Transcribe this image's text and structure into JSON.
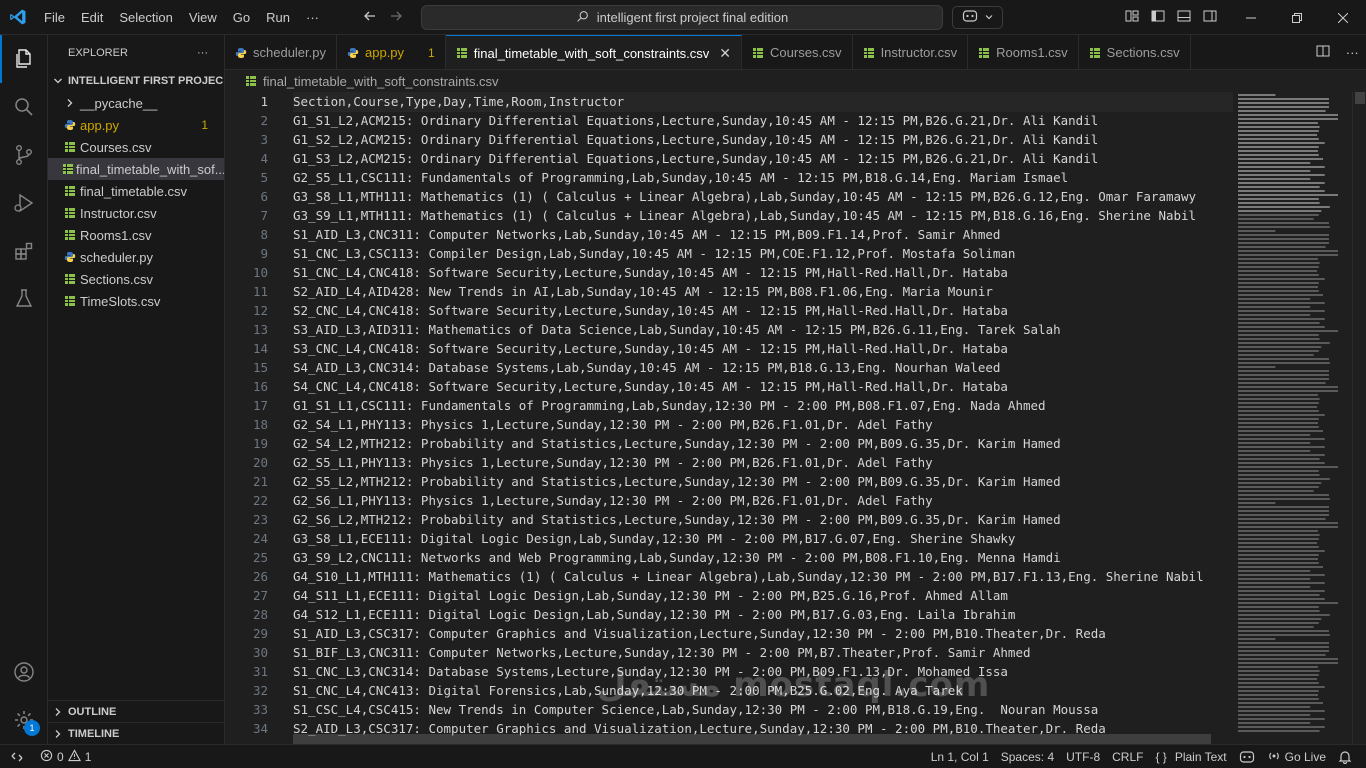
{
  "titlebar": {
    "menu": [
      "File",
      "Edit",
      "Selection",
      "View",
      "Go",
      "Run",
      "···"
    ],
    "search_text": "intelligent first project final edition"
  },
  "colors": {
    "accent": "#0078d4",
    "warning": "#cca700",
    "csv_icon": "#8dc149",
    "python_icon": "#3b78c4"
  },
  "activitybar": {
    "items": [
      "files-icon",
      "search-icon",
      "source-control-icon",
      "run-debug-icon",
      "extensions-icon",
      "testing-icon"
    ],
    "bottom": [
      "account-icon",
      "manage-gear-icon"
    ],
    "manage_badge": "1"
  },
  "sidebar": {
    "title": "EXPLORER",
    "more": "···",
    "folder": "INTELLIGENT FIRST PROJEC...",
    "files": [
      {
        "name": "__pycache__",
        "type": "folder"
      },
      {
        "name": "app.py",
        "type": "python",
        "badge": "1"
      },
      {
        "name": "Courses.csv",
        "type": "csv"
      },
      {
        "name": "final_timetable_with_sof...",
        "type": "csv"
      },
      {
        "name": "final_timetable.csv",
        "type": "csv"
      },
      {
        "name": "Instructor.csv",
        "type": "csv"
      },
      {
        "name": "Rooms1.csv",
        "type": "csv"
      },
      {
        "name": "scheduler.py",
        "type": "python"
      },
      {
        "name": "Sections.csv",
        "type": "csv"
      },
      {
        "name": "TimeSlots.csv",
        "type": "csv"
      }
    ],
    "outline": "OUTLINE",
    "timeline": "TIMELINE"
  },
  "tabs": [
    {
      "label": "scheduler.py",
      "type": "python"
    },
    {
      "label": "app.py",
      "type": "python",
      "badge": "1"
    },
    {
      "label": "final_timetable_with_soft_constraints.csv",
      "type": "csv",
      "active": true,
      "close": "✕"
    },
    {
      "label": "Courses.csv",
      "type": "csv"
    },
    {
      "label": "Instructor.csv",
      "type": "csv"
    },
    {
      "label": "Rooms1.csv",
      "type": "csv"
    },
    {
      "label": "Sections.csv",
      "type": "csv"
    }
  ],
  "breadcrumb": "final_timetable_with_soft_constraints.csv",
  "editor": {
    "lines": [
      "Section,Course,Type,Day,Time,Room,Instructor",
      "G1_S1_L2,ACM215: Ordinary Differential Equations,Lecture,Sunday,10:45 AM - 12:15 PM,B26.G.21,Dr. Ali Kandil",
      "G1_S2_L2,ACM215: Ordinary Differential Equations,Lecture,Sunday,10:45 AM - 12:15 PM,B26.G.21,Dr. Ali Kandil",
      "G1_S3_L2,ACM215: Ordinary Differential Equations,Lecture,Sunday,10:45 AM - 12:15 PM,B26.G.21,Dr. Ali Kandil",
      "G2_S5_L1,CSC111: Fundamentals of Programming,Lab,Sunday,10:45 AM - 12:15 PM,B18.G.14,Eng. Mariam Ismael",
      "G3_S8_L1,MTH111: Mathematics (1) ( Calculus + Linear Algebra),Lab,Sunday,10:45 AM - 12:15 PM,B26.G.12,Eng. Omar Faramawy",
      "G3_S9_L1,MTH111: Mathematics (1) ( Calculus + Linear Algebra),Lab,Sunday,10:45 AM - 12:15 PM,B18.G.16,Eng. Sherine Nabil",
      "S1_AID_L3,CNC311: Computer Networks,Lab,Sunday,10:45 AM - 12:15 PM,B09.F1.14,Prof. Samir Ahmed",
      "S1_CNC_L3,CSC113: Compiler Design,Lab,Sunday,10:45 AM - 12:15 PM,COE.F1.12,Prof. Mostafa Soliman",
      "S1_CNC_L4,CNC418: Software Security,Lecture,Sunday,10:45 AM - 12:15 PM,Hall-Red.Hall,Dr. Hataba",
      "S2_AID_L4,AID428: New Trends in AI,Lab,Sunday,10:45 AM - 12:15 PM,B08.F1.06,Eng. Maria Mounir",
      "S2_CNC_L4,CNC418: Software Security,Lecture,Sunday,10:45 AM - 12:15 PM,Hall-Red.Hall,Dr. Hataba",
      "S3_AID_L3,AID311: Mathematics of Data Science,Lab,Sunday,10:45 AM - 12:15 PM,B26.G.11,Eng. Tarek Salah",
      "S3_CNC_L4,CNC418: Software Security,Lecture,Sunday,10:45 AM - 12:15 PM,Hall-Red.Hall,Dr. Hataba",
      "S4_AID_L3,CNC314: Database Systems,Lab,Sunday,10:45 AM - 12:15 PM,B18.G.13,Eng. Nourhan Waleed",
      "S4_CNC_L4,CNC418: Software Security,Lecture,Sunday,10:45 AM - 12:15 PM,Hall-Red.Hall,Dr. Hataba",
      "G1_S1_L1,CSC111: Fundamentals of Programming,Lab,Sunday,12:30 PM - 2:00 PM,B08.F1.07,Eng. Nada Ahmed",
      "G2_S4_L1,PHY113: Physics 1,Lecture,Sunday,12:30 PM - 2:00 PM,B26.F1.01,Dr. Adel Fathy",
      "G2_S4_L2,MTH212: Probability and Statistics,Lecture,Sunday,12:30 PM - 2:00 PM,B09.G.35,Dr. Karim Hamed",
      "G2_S5_L1,PHY113: Physics 1,Lecture,Sunday,12:30 PM - 2:00 PM,B26.F1.01,Dr. Adel Fathy",
      "G2_S5_L2,MTH212: Probability and Statistics,Lecture,Sunday,12:30 PM - 2:00 PM,B09.G.35,Dr. Karim Hamed",
      "G2_S6_L1,PHY113: Physics 1,Lecture,Sunday,12:30 PM - 2:00 PM,B26.F1.01,Dr. Adel Fathy",
      "G2_S6_L2,MTH212: Probability and Statistics,Lecture,Sunday,12:30 PM - 2:00 PM,B09.G.35,Dr. Karim Hamed",
      "G3_S8_L1,ECE111: Digital Logic Design,Lab,Sunday,12:30 PM - 2:00 PM,B17.G.07,Eng. Sherine Shawky",
      "G3_S9_L2,CNC111: Networks and Web Programming,Lab,Sunday,12:30 PM - 2:00 PM,B08.F1.10,Eng. Menna Hamdi",
      "G4_S10_L1,MTH111: Mathematics (1) ( Calculus + Linear Algebra),Lab,Sunday,12:30 PM - 2:00 PM,B17.F1.13,Eng. Sherine Nabil",
      "G4_S11_L1,ECE111: Digital Logic Design,Lab,Sunday,12:30 PM - 2:00 PM,B25.G.16,Prof. Ahmed Allam",
      "G4_S12_L1,ECE111: Digital Logic Design,Lab,Sunday,12:30 PM - 2:00 PM,B17.G.03,Eng. Laila Ibrahim",
      "S1_AID_L3,CSC317: Computer Graphics and Visualization,Lecture,Sunday,12:30 PM - 2:00 PM,B10.Theater,Dr. Reda",
      "S1_BIF_L3,CNC311: Computer Networks,Lecture,Sunday,12:30 PM - 2:00 PM,B7.Theater,Prof. Samir Ahmed",
      "S1_CNC_L3,CNC314: Database Systems,Lecture,Sunday,12:30 PM - 2:00 PM,B09.F1.13,Dr. Mohamed Issa",
      "S1_CNC_L4,CNC413: Digital Forensics,Lab,Sunday,12:30 PM - 2:00 PM,B25.G.02,Eng. Aya Tarek",
      "S1_CSC_L4,CSC415: New Trends in Computer Science,Lab,Sunday,12:30 PM - 2:00 PM,B18.G.19,Eng.  Nouran Moussa",
      "S2_AID_L3,CSC317: Computer Graphics and Visualization,Lecture,Sunday,12:30 PM - 2:00 PM,B10.Theater,Dr. Reda"
    ],
    "current_line": 1,
    "watermark": "مستقل mostaql.com"
  },
  "statusbar": {
    "problems_errors": "0",
    "problems_warnings": "1",
    "position": "Ln 1, Col 1",
    "spaces": "Spaces: 4",
    "encoding": "UTF-8",
    "eol": "CRLF",
    "language": "Plain Text",
    "golive": "Go Live"
  }
}
